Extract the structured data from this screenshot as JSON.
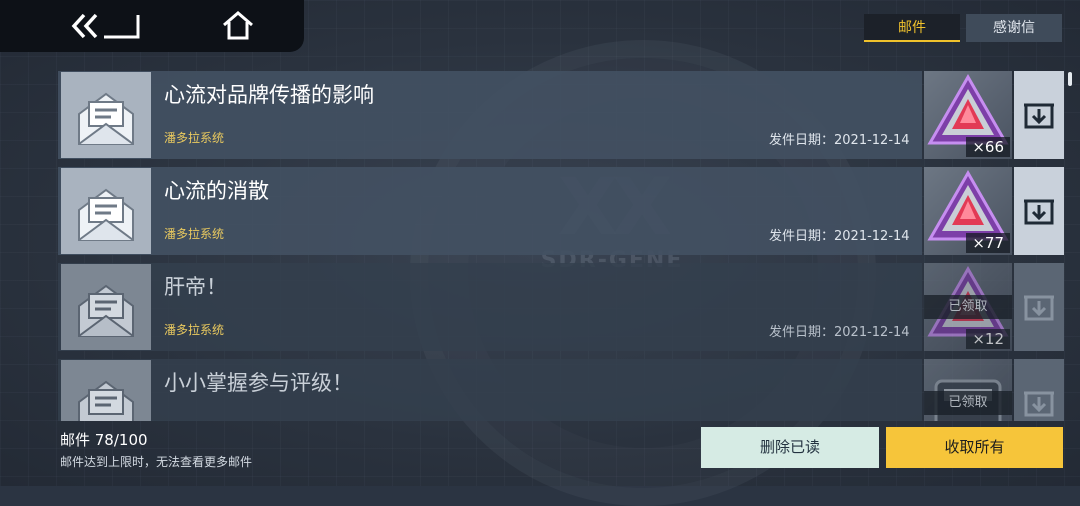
{
  "nav": {
    "back_icon": "back-arrow-icon",
    "home_icon": "home-icon"
  },
  "tabs": [
    {
      "label": "邮件",
      "active": true
    },
    {
      "label": "感谢信",
      "active": false
    }
  ],
  "mails": [
    {
      "title": "心流对品牌传播的影响",
      "sender": "潘多拉系统",
      "date": "发件日期：2021-12-14",
      "reward_qty": "×66",
      "claimed": "",
      "reward_icon": "red-crystal-icon"
    },
    {
      "title": "心流的消散",
      "sender": "潘多拉系统",
      "date": "发件日期：2021-12-14",
      "reward_qty": "×77",
      "claimed": "",
      "reward_icon": "red-crystal-icon"
    },
    {
      "title": "肝帝！",
      "sender": "潘多拉系统",
      "date": "发件日期：2021-12-14",
      "reward_qty": "×12",
      "claimed": "已领取",
      "reward_icon": "red-crystal-icon"
    },
    {
      "title": "小小掌握参与评级！",
      "sender": "",
      "date": "",
      "reward_qty": "",
      "claimed": "已领取",
      "reward_icon": "gray-chest-icon"
    }
  ],
  "footer": {
    "count": "邮件 78/100",
    "hint": "邮件达到上限时，无法查看更多邮件",
    "delete_label": "删除已读",
    "claim_all_label": "收取所有"
  },
  "background_logo": {
    "mark": "XX",
    "text": "SDR-GENE"
  },
  "colors": {
    "accent": "#f6c53a",
    "sender": "#e9c95f",
    "delete_bg": "#d6ebe4"
  }
}
